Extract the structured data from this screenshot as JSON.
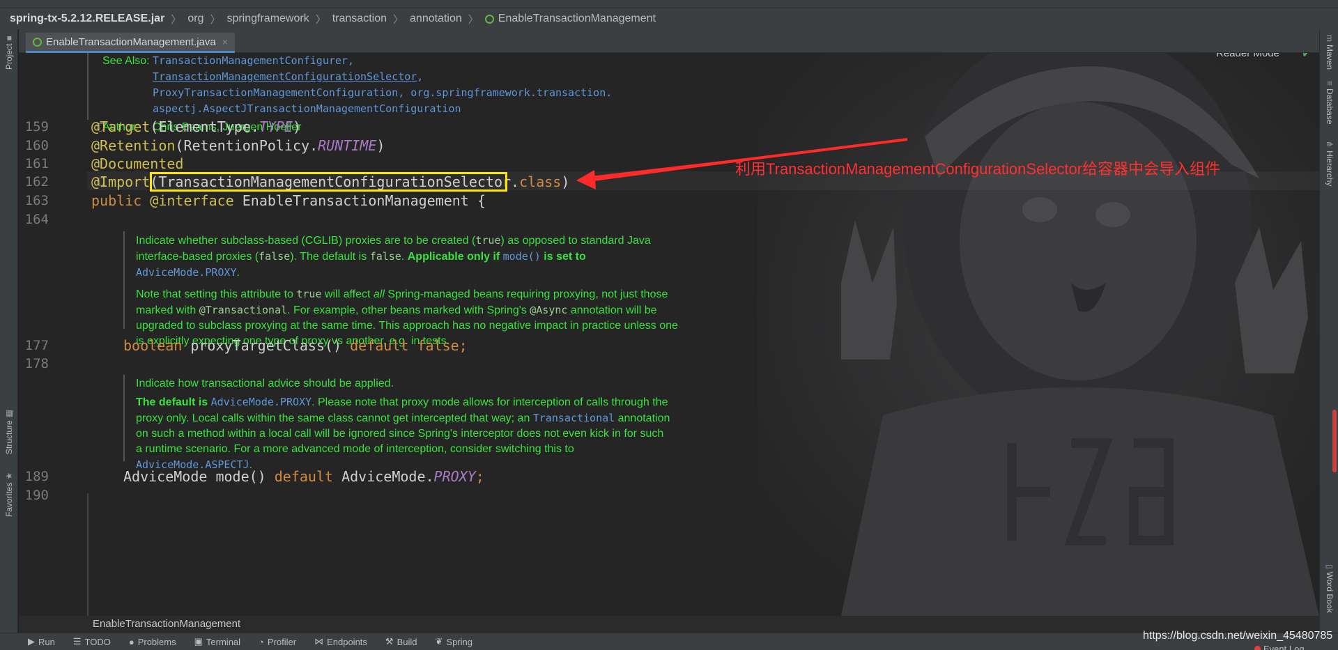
{
  "breadcrumb": {
    "items": [
      "spring-tx-5.2.12.RELEASE.jar",
      "org",
      "springframework",
      "transaction",
      "annotation",
      "EnableTransactionManagement"
    ]
  },
  "tab": {
    "title": "EnableTransactionManagement.java",
    "close": "×"
  },
  "reader_mode": "Reader Mode",
  "left_tools": {
    "project": "Project",
    "structure": "Structure",
    "favorites": "Favorites"
  },
  "right_tools": {
    "maven": "Maven",
    "database": "Database",
    "hierarchy": "Hierarchy",
    "word_book": "Word Book"
  },
  "see_also": {
    "label": "See Also:",
    "links": [
      "TransactionManagementConfigurer,",
      "TransactionManagementConfigurationSelector",
      ",",
      "ProxyTransactionManagementConfiguration",
      ", org.springframework.transaction.",
      "aspectj.AspectJTransactionManagementConfiguration"
    ]
  },
  "author": {
    "label": "Author:",
    "value": "Chris Beams, Juergen Hoeller"
  },
  "lines": {
    "n159": "159",
    "n160": "160",
    "n161": "161",
    "n162": "162",
    "n163": "163",
    "n164": "164",
    "n177": "177",
    "n178": "178",
    "n189": "189",
    "n190": "190"
  },
  "code": {
    "l159": {
      "at": "@Target",
      "p1": "(ElementType.",
      "c": "TYPE",
      "p2": ")"
    },
    "l160": {
      "at": "@Retention",
      "p1": "(RetentionPolicy.",
      "c": "RUNTIME",
      "p2": ")"
    },
    "l161": {
      "at": "@Documented"
    },
    "l162": {
      "at": "@Import",
      "p1": "(TransactionManagementConfigurationSelector.",
      "k": "class",
      "p2": ")"
    },
    "l163": {
      "k1": "public",
      "at": " @interface",
      "rest": " EnableTransactionManagement {"
    },
    "l177": {
      "k1": "boolean",
      "rest": " proxyTargetClass() ",
      "k2": "default false",
      "end": ";"
    },
    "l189": {
      "t1": "AdviceMode mode() ",
      "k": "default",
      "t2": " AdviceMode.",
      "c": "PROXY",
      "end": ";"
    }
  },
  "doc1": {
    "p1a": "Indicate whether subclass-based (CGLIB) proxies are to be created (",
    "p1b": "true",
    "p1c": ") as opposed to standard Java interface-based proxies (",
    "p1d": "false",
    "p1e": "). The default is ",
    "p1f": "false",
    "p1g": ". ",
    "p1h": "Applicable only if ",
    "p1i": "mode()",
    "p1j": " is set to",
    "p1k": "AdviceMode.PROXY",
    "p1l": ".",
    "p2a": "Note that setting this attribute to ",
    "p2b": "true",
    "p2c": " will affect ",
    "p2d": "all",
    "p2e": " Spring-managed beans requiring proxying, not just those marked with ",
    "p2f": "@Transactional",
    "p2g": ". For example, other beans marked with Spring's ",
    "p2h": "@Async",
    "p2i": " annotation will be upgraded to subclass proxying at the same time. This approach has no negative impact in practice unless one is explicitly expecting one type of proxy vs another, e.g. in tests."
  },
  "doc2": {
    "p1": "Indicate how transactional advice should be applied.",
    "p2a": "The default is ",
    "p2b": "AdviceMode.PROXY",
    "p2c": ". Please note that proxy mode allows for interception of calls through the proxy only. Local calls within the same class cannot get intercepted that way; an ",
    "p2d": "Transactional",
    "p2e": " annotation on such a method within a local call will be ignored since Spring's interceptor does not even kick in for such a runtime scenario. For a more advanced mode of interception, consider switching this to ",
    "p2f": "AdviceMode.ASPECTJ",
    "p2g": "."
  },
  "callout": "利用TransactionManagementConfigurationSelector给容器中会导入组件",
  "footer_crumb": "EnableTransactionManagement",
  "status_tabs": [
    "Run",
    "TODO",
    "Problems",
    "Terminal",
    "Profiler",
    "Endpoints",
    "Build",
    "Spring"
  ],
  "event_log": "Event Log",
  "watermark": "https://blog.csdn.net/weixin_45480785",
  "colors": {
    "callout": "#ff3030",
    "highlight_box": "#ffe600",
    "doc_text": "#3ae23c",
    "link": "#5f97d8"
  }
}
